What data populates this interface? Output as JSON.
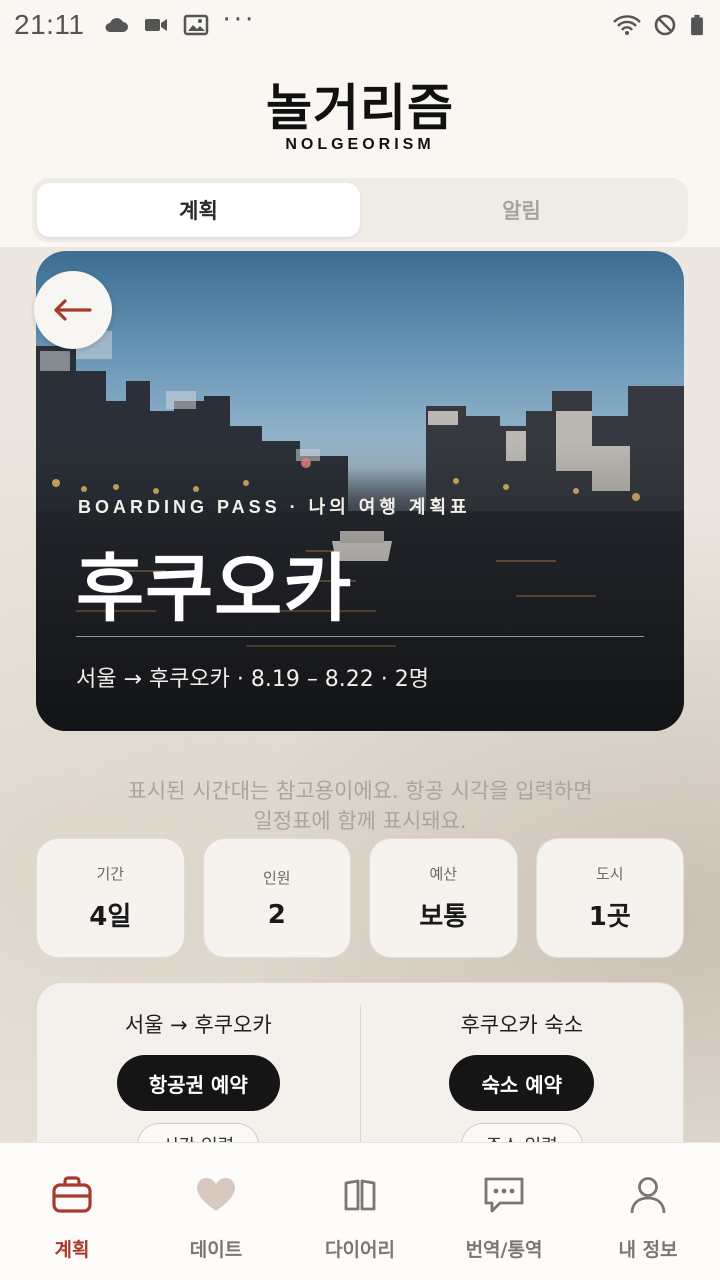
{
  "status_bar": {
    "time": "21:11",
    "left_icons": [
      "cloud-icon",
      "video-icon",
      "image-icon",
      "more-dots-icon"
    ],
    "right_icons": [
      "wifi-icon",
      "do-not-disturb-icon",
      "battery-icon"
    ],
    "more": "···"
  },
  "header": {
    "logo": "놀거리즘",
    "logo_sub": "NOLGEORISM"
  },
  "segment": {
    "tabs": [
      {
        "label": "계획",
        "active": true
      },
      {
        "label": "알림",
        "active": false
      }
    ]
  },
  "hero": {
    "back_icon": "arrow-left-icon",
    "kicker": "BOARDING PASS · 나의 여행 계획표",
    "title": "후쿠오카",
    "route": "서울 → 후쿠오카 · 8.19 – 8.22 · 2명"
  },
  "note": {
    "line1": "표시된 시간대는 참고용이에요. 항공 시각을 입력하면",
    "line2": "일정표에 함께 표시돼요."
  },
  "stats": [
    {
      "label": "기간",
      "value": "4일"
    },
    {
      "label": "인원",
      "value": "2"
    },
    {
      "label": "예산",
      "value": "보통"
    },
    {
      "label": "도시",
      "value": "1곳"
    }
  ],
  "booking": {
    "flight": {
      "title": "서울 → 후쿠오카",
      "button": "항공권 예약",
      "sub": "시간 입력"
    },
    "hotel": {
      "title": "후쿠오카 숙소",
      "button": "숙소 예약",
      "sub": "주소 입력"
    }
  },
  "bottom_nav": {
    "items": [
      {
        "label": "계획",
        "icon": "briefcase-icon",
        "active": true
      },
      {
        "label": "데이트",
        "icon": "heart-icon",
        "active": false
      },
      {
        "label": "다이어리",
        "icon": "book-icon",
        "active": false
      },
      {
        "label": "번역/통역",
        "icon": "chat-bubble-icon",
        "active": false
      },
      {
        "label": "내 정보",
        "icon": "person-icon",
        "active": false
      }
    ]
  },
  "colors": {
    "accent": "#a83a2c",
    "background": "#faf7f2",
    "button_dark": "#151515"
  }
}
